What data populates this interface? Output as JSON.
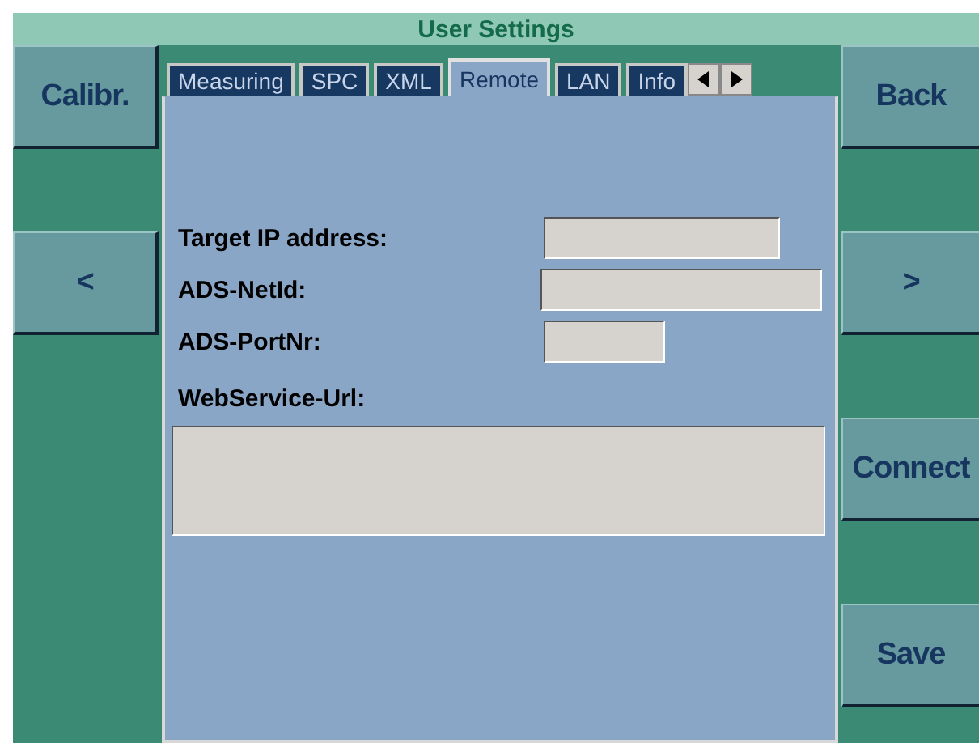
{
  "window": {
    "title": "User Settings"
  },
  "left_buttons": [
    "Calibr.",
    "<"
  ],
  "right_buttons": [
    "Back",
    ">",
    "Connect",
    "Save"
  ],
  "tabs": [
    {
      "label": "Measuring",
      "selected": false
    },
    {
      "label": "SPC",
      "selected": false
    },
    {
      "label": "XML",
      "selected": false
    },
    {
      "label": "Remote",
      "selected": true
    },
    {
      "label": "LAN",
      "selected": false
    },
    {
      "label": "Info",
      "selected": false
    }
  ],
  "fields": [
    {
      "label": "Target IP address:",
      "kind": "inline"
    },
    {
      "label": "ADS-NetId:",
      "kind": "inline"
    },
    {
      "label": "ADS-PortNr:",
      "kind": "inline"
    },
    {
      "label": "WebService-Url:",
      "kind": "block"
    }
  ]
}
